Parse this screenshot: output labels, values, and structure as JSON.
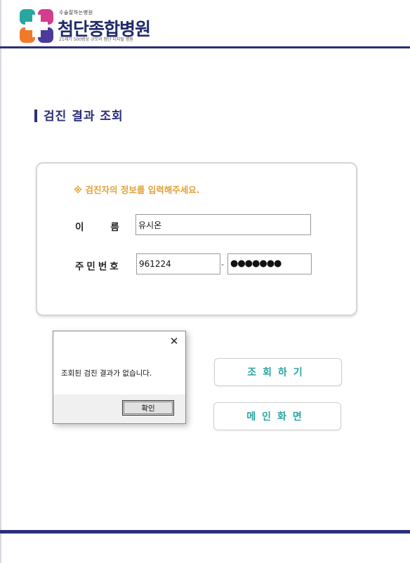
{
  "header": {
    "slogan": "수술잘하는병원",
    "hospital_name": "첨단종합병원",
    "subtitle": "21세기 500병상 규모의 첨단 디지털 병원",
    "logo_icon": "cross-logo-icon",
    "colors": {
      "navy": "#2b2f7a",
      "teal": "#2aa6a1",
      "magenta": "#d43c8c",
      "orange": "#f07a2a",
      "purple": "#4a3a9a"
    }
  },
  "page": {
    "title": "검진 결과 조회"
  },
  "form": {
    "notice": "※ 검진자의 정보를 입력해주세요.",
    "name_label_1": "이",
    "name_label_2": "름",
    "name_value": "유시온",
    "ssn_label": "주민번호",
    "ssn_front": "961224",
    "ssn_dash": "-",
    "ssn_back_masked": "●●●●●●●"
  },
  "buttons": {
    "query": "조회하기",
    "home": "메인화면"
  },
  "dialog": {
    "message": "조회된 검진 결과가 없습니다.",
    "ok_label": "확인",
    "close_icon": "close-icon"
  }
}
